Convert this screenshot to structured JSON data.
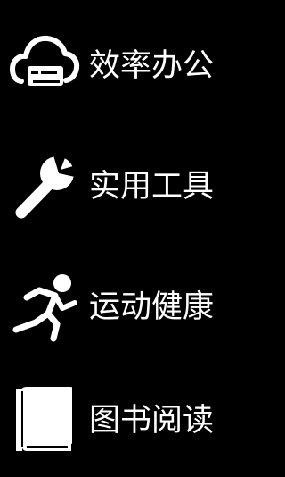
{
  "theme": {
    "background": "#000000",
    "foreground": "#ffffff"
  },
  "menu": {
    "items": [
      {
        "label": "效率办公",
        "icon": "cloud-printer-icon"
      },
      {
        "label": "实用工具",
        "icon": "wrench-icon"
      },
      {
        "label": "运动健康",
        "icon": "running-person-icon"
      },
      {
        "label": "图书阅读",
        "icon": "book-icon"
      }
    ]
  }
}
